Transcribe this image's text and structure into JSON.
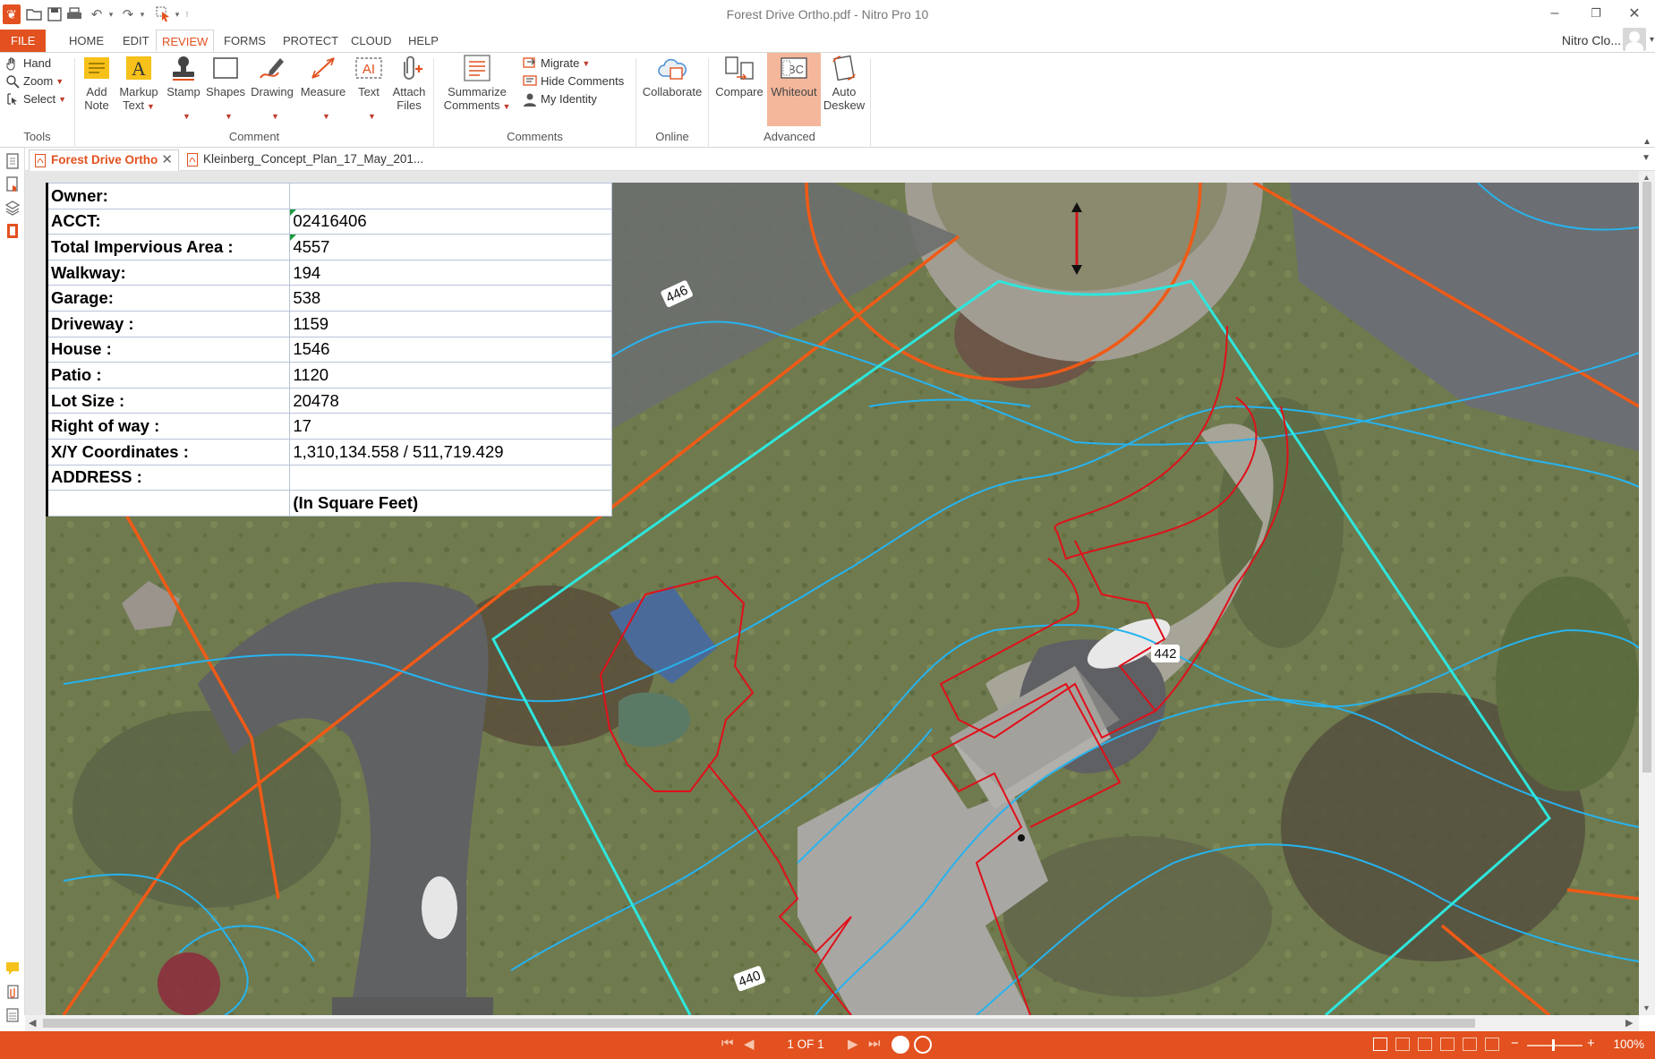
{
  "window": {
    "title": "Forest Drive Ortho.pdf - Nitro Pro 10",
    "minimize": "–",
    "restore": "❐",
    "close": "✕"
  },
  "menu": {
    "file": "FILE",
    "tabs": [
      "HOME",
      "EDIT",
      "REVIEW",
      "FORMS",
      "PROTECT",
      "CLOUD",
      "HELP"
    ],
    "active": "REVIEW",
    "user": "Nitro Clo..."
  },
  "ribbon": {
    "tools": {
      "hand": "Hand",
      "zoom": "Zoom",
      "select": "Select",
      "group": "Tools"
    },
    "comment": {
      "add_note": [
        "Add",
        "Note"
      ],
      "markup_text": [
        "Markup",
        "Text"
      ],
      "stamp": "Stamp",
      "shapes": "Shapes",
      "drawing": "Drawing",
      "measure": "Measure",
      "text": "Text",
      "attach_files": [
        "Attach",
        "Files"
      ],
      "group": "Comment"
    },
    "comments": {
      "summarize": [
        "Summarize",
        "Comments"
      ],
      "migrate": "Migrate",
      "hide_comments": "Hide Comments",
      "my_identity": "My Identity",
      "group": "Comments"
    },
    "online": {
      "collaborate": "Collaborate",
      "group": "Online"
    },
    "advanced": {
      "compare": "Compare",
      "whiteout": "Whiteout",
      "auto_deskew": [
        "Auto",
        "Deskew"
      ],
      "group": "Advanced"
    }
  },
  "doc_tabs": [
    {
      "label": "Forest Drive Ortho",
      "active": true
    },
    {
      "label": "Kleinberg_Concept_Plan_17_May_201..."
    }
  ],
  "property_table": {
    "rows": [
      {
        "label": "Owner:",
        "value": ""
      },
      {
        "label": "ACCT:",
        "value": "02416406"
      },
      {
        "label": "Total Impervious Area :",
        "value": "4557"
      },
      {
        "label": "Walkway:",
        "value": "194"
      },
      {
        "label": "Garage:",
        "value": "538"
      },
      {
        "label": "Driveway :",
        "value": "1159"
      },
      {
        "label": "House :",
        "value": "1546"
      },
      {
        "label": "Patio :",
        "value": "1120"
      },
      {
        "label": "Lot Size :",
        "value": "20478"
      },
      {
        "label": "Right of way :",
        "value": "17"
      },
      {
        "label": "X/Y Coordinates :",
        "value": "1,310,134.558 / 511,719.429"
      },
      {
        "label": "ADDRESS :",
        "value": ""
      },
      {
        "label": "",
        "value": "(In Square Feet)"
      }
    ]
  },
  "map": {
    "house_labels": [
      "446",
      "442",
      "440"
    ],
    "colors": {
      "lot_line": "#2ee6dc",
      "parcel": "#f05a16",
      "contour": "#27b3ee",
      "impervious": "#e0101a"
    }
  },
  "status": {
    "page_indicator": "1 OF 1",
    "zoom": "100%"
  },
  "colors": {
    "accent": "#e2511f",
    "ribbon_selected": "#f4b79b"
  }
}
